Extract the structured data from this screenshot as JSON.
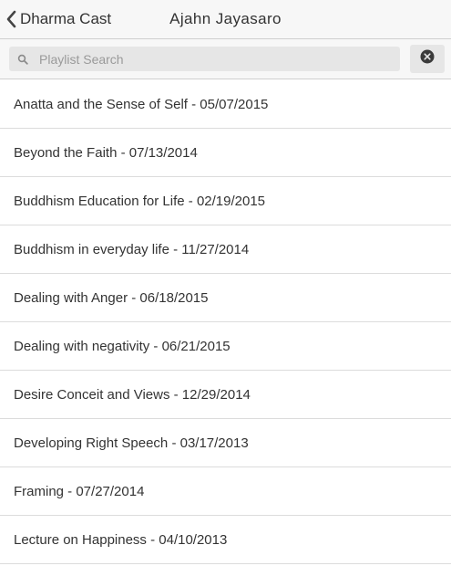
{
  "header": {
    "back_label": "Dharma Cast",
    "title": "Ajahn Jayasaro"
  },
  "search": {
    "placeholder": "Playlist Search",
    "value": ""
  },
  "icons": {
    "back": "chevron-left-icon",
    "search": "search-icon",
    "clear": "close-circle-icon"
  },
  "playlist": {
    "items": [
      {
        "label": "Anatta and the Sense of Self - 05/07/2015"
      },
      {
        "label": "Beyond the Faith - 07/13/2014"
      },
      {
        "label": "Buddhism Education for Life - 02/19/2015"
      },
      {
        "label": "Buddhism in everyday life - 11/27/2014"
      },
      {
        "label": "Dealing with Anger - 06/18/2015"
      },
      {
        "label": "Dealing with negativity - 06/21/2015"
      },
      {
        "label": "Desire Conceit and Views - 12/29/2014"
      },
      {
        "label": "Developing Right Speech - 03/17/2013"
      },
      {
        "label": "Framing - 07/27/2014"
      },
      {
        "label": "Lecture on Happiness - 04/10/2013"
      }
    ]
  },
  "colors": {
    "header_background": "#f7f7f7",
    "search_field_background": "#e6e6e6",
    "text": "#333333",
    "divider": "#dcdcdc"
  }
}
